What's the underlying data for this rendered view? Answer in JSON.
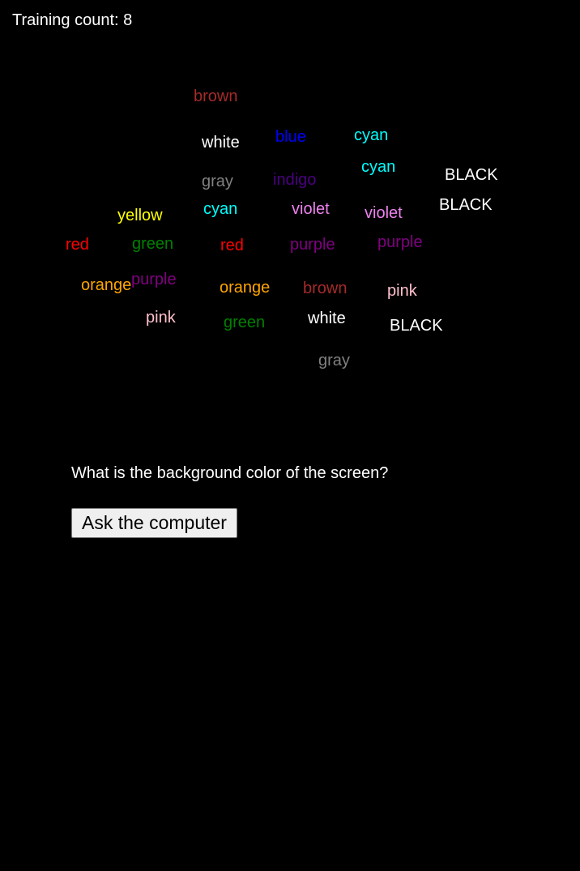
{
  "counter": {
    "label": "Training count: 8"
  },
  "words": [
    {
      "text": "brown",
      "color": "#a52a2a"
    },
    {
      "text": "white",
      "color": "#ffffff"
    },
    {
      "text": "blue",
      "color": "#0000ff"
    },
    {
      "text": "cyan",
      "color": "#00ffff"
    },
    {
      "text": "gray",
      "color": "#808080"
    },
    {
      "text": "indigo",
      "color": "#4b0082"
    },
    {
      "text": "cyan",
      "color": "#00ffff"
    },
    {
      "text": "BLACK",
      "color": "#ffffff"
    },
    {
      "text": "BLACK",
      "color": "#ffffff"
    },
    {
      "text": "yellow",
      "color": "#ffff00"
    },
    {
      "text": "cyan",
      "color": "#00ffff"
    },
    {
      "text": "violet",
      "color": "#ee82ee"
    },
    {
      "text": "violet",
      "color": "#ee82ee"
    },
    {
      "text": "red",
      "color": "#ff0000"
    },
    {
      "text": "green",
      "color": "#008000"
    },
    {
      "text": "red",
      "color": "#ff0000"
    },
    {
      "text": "purple",
      "color": "#800080"
    },
    {
      "text": "purple",
      "color": "#800080"
    },
    {
      "text": "orange",
      "color": "#ffa500"
    },
    {
      "text": "purple",
      "color": "#800080"
    },
    {
      "text": "orange",
      "color": "#ffa500"
    },
    {
      "text": "brown",
      "color": "#a52a2a"
    },
    {
      "text": "pink",
      "color": "#ffc0cb"
    },
    {
      "text": "pink",
      "color": "#ffc0cb"
    },
    {
      "text": "green",
      "color": "#008000"
    },
    {
      "text": "white",
      "color": "#ffffff"
    },
    {
      "text": "BLACK",
      "color": "#ffffff"
    },
    {
      "text": "gray",
      "color": "#808080"
    }
  ],
  "question": {
    "text": "What is the background color of the screen?"
  },
  "ask_button": {
    "label": "Ask the computer"
  },
  "colors": {
    "background": "#000000",
    "text": "#ffffff",
    "button_bg": "#efefef"
  }
}
